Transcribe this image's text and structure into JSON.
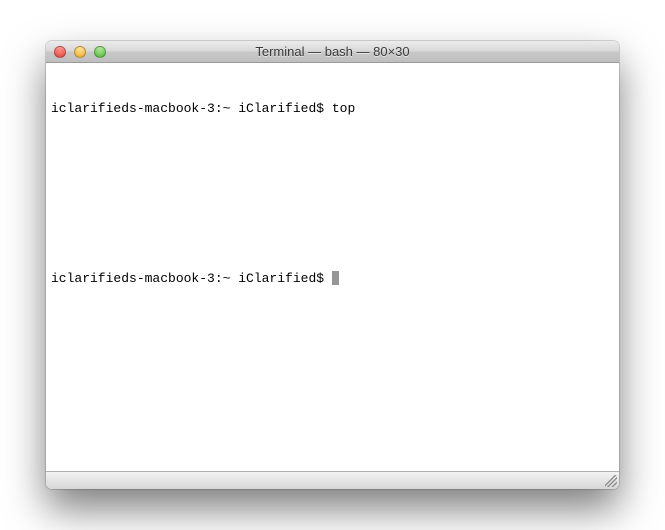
{
  "window": {
    "title": "Terminal — bash — 80×30"
  },
  "terminal": {
    "lines": [
      {
        "prompt": "iclarifieds-macbook-3:~ iClarified$ ",
        "command": "top"
      }
    ],
    "current_prompt": "iclarifieds-macbook-3:~ iClarified$ "
  }
}
